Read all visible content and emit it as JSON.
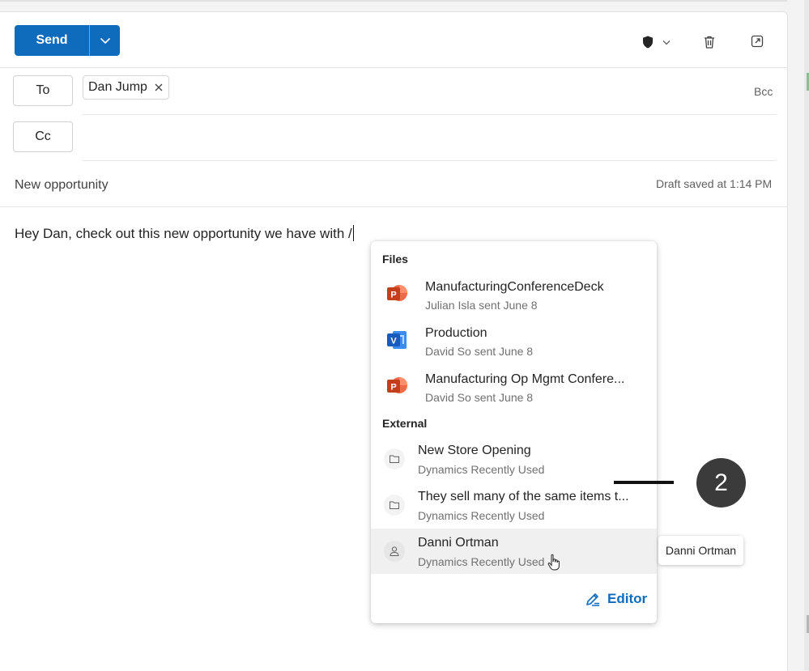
{
  "toolbar": {
    "send_label": "Send",
    "send_dropdown_icon": "chevron-down-icon",
    "sensitivity_icon": "shield-icon",
    "delete_icon": "trash-icon",
    "popout_icon": "popout-icon"
  },
  "recipients": {
    "to_label": "To",
    "to_chip": "Dan Jump",
    "cc_label": "Cc",
    "bcc_label": "Bcc"
  },
  "subject": "New opportunity",
  "draft_status": "Draft saved at 1:14 PM",
  "body_text": "Hey Dan, check out this new opportunity we have with /",
  "suggestions": {
    "files_heading": "Files",
    "files": [
      {
        "title": "ManufacturingConferenceDeck",
        "subtitle": "Julian Isla sent June 8",
        "icon": "powerpoint-icon"
      },
      {
        "title": "Production",
        "subtitle": "David So sent June 8",
        "icon": "visio-icon"
      },
      {
        "title": "Manufacturing Op Mgmt Confere...",
        "subtitle": "David So sent June 8",
        "icon": "powerpoint-icon"
      }
    ],
    "external_heading": "External",
    "external": [
      {
        "title": "New Store Opening",
        "subtitle": "Dynamics Recently Used",
        "icon": "folder-icon"
      },
      {
        "title": "They sell many of the same items t...",
        "subtitle": "Dynamics Recently Used",
        "icon": "folder-icon"
      },
      {
        "title": "Danni Ortman",
        "subtitle": "Dynamics Recently Used",
        "icon": "person-icon"
      }
    ],
    "editor_label": "Editor"
  },
  "tooltip": "Danni Ortman",
  "callout_number": "2",
  "colors": {
    "accent": "#0f6cbd",
    "powerpoint": "#c43e1c",
    "visio": "#185abd"
  }
}
